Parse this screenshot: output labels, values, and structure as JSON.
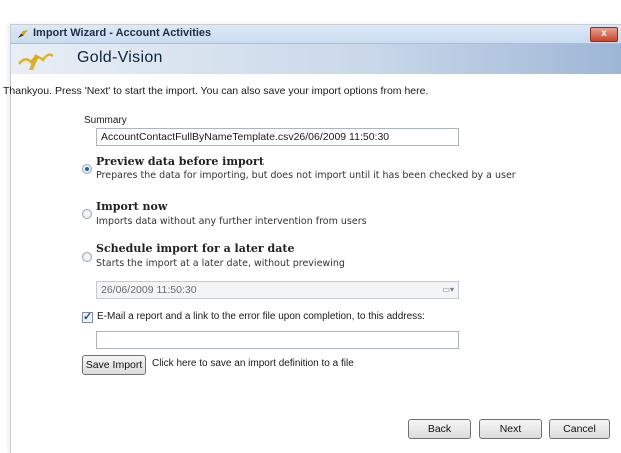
{
  "window": {
    "title": "Import Wizard - Account Activities",
    "close_glyph": "x",
    "brand": "Gold-Vision",
    "icons": {
      "app": "gold-wing-icon",
      "close": "close-icon",
      "calendar": "calendar-icon"
    }
  },
  "intro_text": "Thankyou. Press 'Next' to start the import. You can also save your import options from here.",
  "summary": {
    "label": "Summary",
    "value": "AccountContactFullByNameTemplate.csv26/06/2009 11:50:30"
  },
  "options": [
    {
      "title": "Preview data before import",
      "description": "Prepares the data for importing, but does not import until it has been checked by a user",
      "selected": true
    },
    {
      "title": "Import now",
      "description": "Imports data without any further intervention from users",
      "selected": false
    },
    {
      "title": "Schedule import for a later date",
      "description": "Starts the import at a later date, without previewing",
      "selected": false
    }
  ],
  "schedule_date": "26/06/2009 11:50:30",
  "email": {
    "checked": true,
    "label": "E-Mail a report and a link to the error file upon completion, to this address:",
    "value": ""
  },
  "save": {
    "button_label": "Save Import",
    "hint": "Click here to save an import definition to a file"
  },
  "nav": {
    "back": "Back",
    "next": "Next",
    "cancel": "Cancel"
  }
}
